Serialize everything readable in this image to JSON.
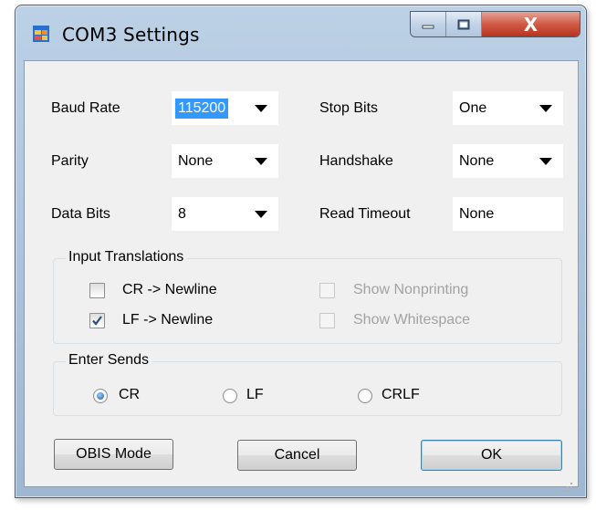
{
  "window": {
    "title": "COM3 Settings",
    "icon": "app-window-icon",
    "close_glyph": "X"
  },
  "serial": {
    "baud_rate": {
      "label": "Baud Rate",
      "value": "115200"
    },
    "parity": {
      "label": "Parity",
      "value": "None"
    },
    "data_bits": {
      "label": "Data Bits",
      "value": "8"
    },
    "stop_bits": {
      "label": "Stop Bits",
      "value": "One"
    },
    "handshake": {
      "label": "Handshake",
      "value": "None"
    },
    "read_timeout": {
      "label": "Read Timeout",
      "value": "None"
    }
  },
  "input_translations": {
    "title": "Input Translations",
    "options": [
      {
        "label": "CR -> Newline",
        "checked": false,
        "enabled": true
      },
      {
        "label": "LF -> Newline",
        "checked": true,
        "enabled": true
      },
      {
        "label": "Show Nonprinting",
        "checked": false,
        "enabled": false
      },
      {
        "label": "Show Whitespace",
        "checked": false,
        "enabled": false
      }
    ]
  },
  "enter_sends": {
    "title": "Enter Sends",
    "options": [
      {
        "label": "CR",
        "selected": true
      },
      {
        "label": "LF",
        "selected": false
      },
      {
        "label": "CRLF",
        "selected": false
      }
    ]
  },
  "buttons": {
    "obis": "OBIS Mode",
    "cancel": "Cancel",
    "ok": "OK"
  },
  "colors": {
    "selection": "#3399ff",
    "dialog_bg": "#f0f0f0",
    "close_button": "#c9462f"
  }
}
